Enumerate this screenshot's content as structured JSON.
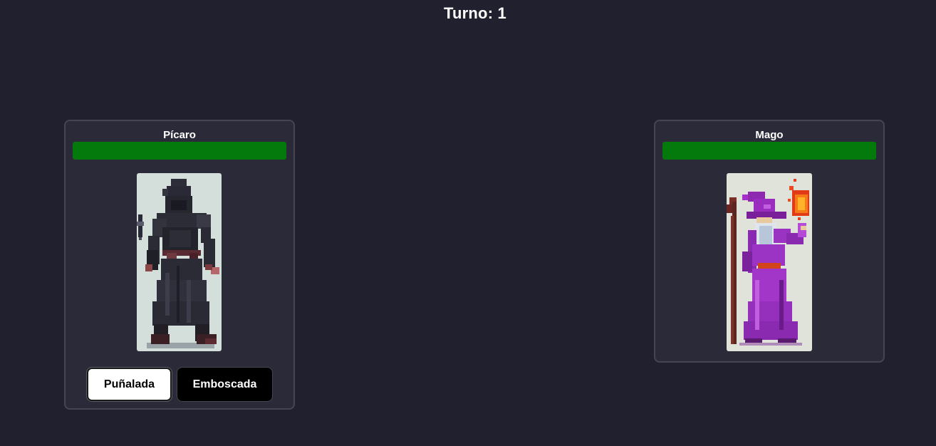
{
  "turn": {
    "label": "Turno: 1"
  },
  "player": {
    "name": "Pícaro",
    "hp_fraction": 1.0,
    "hp_color": "#037a0b",
    "portrait_icon": "hooded-rogue-sprite",
    "actions": [
      {
        "label": "Puñalada",
        "style": "light"
      },
      {
        "label": "Emboscada",
        "style": "dark"
      }
    ]
  },
  "enemy": {
    "name": "Mago",
    "hp_fraction": 1.0,
    "hp_color": "#037a0b",
    "portrait_icon": "wizard-sprite"
  },
  "colors": {
    "background": "#20202f",
    "panel": "#2a2a38",
    "panel_border": "#464652"
  }
}
